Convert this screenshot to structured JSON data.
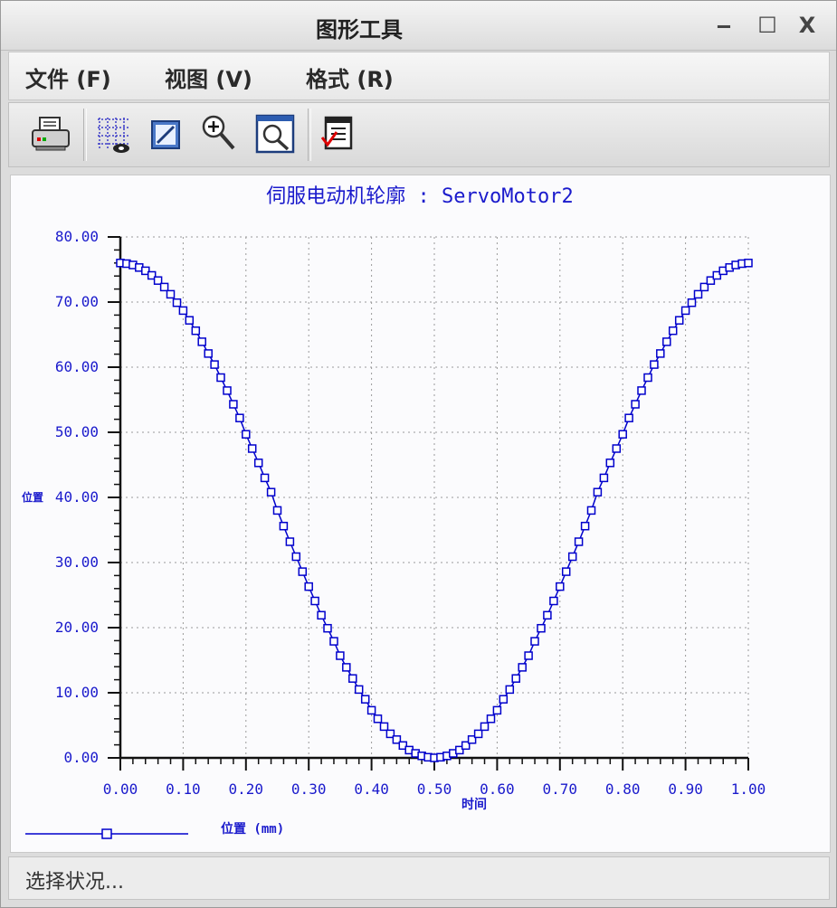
{
  "window": {
    "title": "图形工具",
    "controls": {
      "minimize": "‒",
      "maximize": "☐",
      "close": "X"
    }
  },
  "menu": {
    "items": [
      {
        "label": "文件 (F)"
      },
      {
        "label": "视图 (V)"
      },
      {
        "label": "格式 (R)"
      }
    ]
  },
  "toolbar": {
    "tools": [
      "printer-icon",
      "grid-icon",
      "edit-icon",
      "zoom-in-icon",
      "zoom-fit-icon",
      "export-icon"
    ]
  },
  "chart_data": {
    "type": "line",
    "title": "伺服电动机轮廓 : ServoMotor2",
    "xlabel": "时间",
    "ylabel": "位置",
    "xlim": [
      0,
      1
    ],
    "ylim": [
      0,
      80
    ],
    "x_ticks": [
      "0.00",
      "0.10",
      "0.20",
      "0.30",
      "0.40",
      "0.50",
      "0.60",
      "0.70",
      "0.80",
      "0.90",
      "1.00"
    ],
    "y_ticks": [
      "0.00",
      "10.00",
      "20.00",
      "30.00",
      "40.00",
      "50.00",
      "60.00",
      "70.00",
      "80.00"
    ],
    "grid": true,
    "legend": {
      "placement": "bottom-left",
      "label": "位置 (mm)"
    },
    "series": [
      {
        "name": "位置 (mm)",
        "color": "#0000cc",
        "marker": "square",
        "function": "38*(1+cos(2*pi*x))",
        "x": [
          0.0,
          0.01,
          0.02,
          0.03,
          0.04,
          0.05,
          0.06,
          0.07,
          0.08,
          0.09,
          0.1,
          0.11,
          0.12,
          0.13,
          0.14,
          0.15,
          0.16,
          0.17,
          0.18,
          0.19,
          0.2,
          0.21,
          0.22,
          0.23,
          0.24,
          0.25,
          0.26,
          0.27,
          0.28,
          0.29,
          0.3,
          0.31,
          0.32,
          0.33,
          0.34,
          0.35,
          0.36,
          0.37,
          0.38,
          0.39,
          0.4,
          0.41,
          0.42,
          0.43,
          0.44,
          0.45,
          0.46,
          0.47,
          0.48,
          0.49,
          0.5,
          0.51,
          0.52,
          0.53,
          0.54,
          0.55,
          0.56,
          0.57,
          0.58,
          0.59,
          0.6,
          0.61,
          0.62,
          0.63,
          0.64,
          0.65,
          0.66,
          0.67,
          0.68,
          0.69,
          0.7,
          0.71,
          0.72,
          0.73,
          0.74,
          0.75,
          0.76,
          0.77,
          0.78,
          0.79,
          0.8,
          0.81,
          0.82,
          0.83,
          0.84,
          0.85,
          0.86,
          0.87,
          0.88,
          0.89,
          0.9,
          0.91,
          0.92,
          0.93,
          0.94,
          0.95,
          0.96,
          0.97,
          0.98,
          0.99,
          1.0
        ],
        "y": [
          76.0,
          75.9,
          75.7,
          75.3,
          74.8,
          74.1,
          73.3,
          72.3,
          71.2,
          69.9,
          68.7,
          67.2,
          65.6,
          63.9,
          62.1,
          60.4,
          58.4,
          56.4,
          54.3,
          52.2,
          49.7,
          47.5,
          45.3,
          43.0,
          40.8,
          38.0,
          35.6,
          33.2,
          30.9,
          28.6,
          26.3,
          24.1,
          21.9,
          19.9,
          17.9,
          15.7,
          13.9,
          12.2,
          10.5,
          9.0,
          7.3,
          6.0,
          4.8,
          3.7,
          2.8,
          1.9,
          1.2,
          0.7,
          0.3,
          0.1,
          0.0,
          0.1,
          0.3,
          0.7,
          1.2,
          1.9,
          2.8,
          3.7,
          4.8,
          6.0,
          7.3,
          9.0,
          10.5,
          12.2,
          13.9,
          15.7,
          17.9,
          19.9,
          21.9,
          24.1,
          26.3,
          28.6,
          30.9,
          33.2,
          35.6,
          38.0,
          40.8,
          43.0,
          45.3,
          47.5,
          49.7,
          52.2,
          54.3,
          56.4,
          58.4,
          60.4,
          62.1,
          63.9,
          65.6,
          67.2,
          68.7,
          69.9,
          71.2,
          72.3,
          73.3,
          74.1,
          74.8,
          75.3,
          75.7,
          75.9,
          76.0
        ]
      }
    ]
  },
  "status": {
    "text": "选择状况..."
  }
}
